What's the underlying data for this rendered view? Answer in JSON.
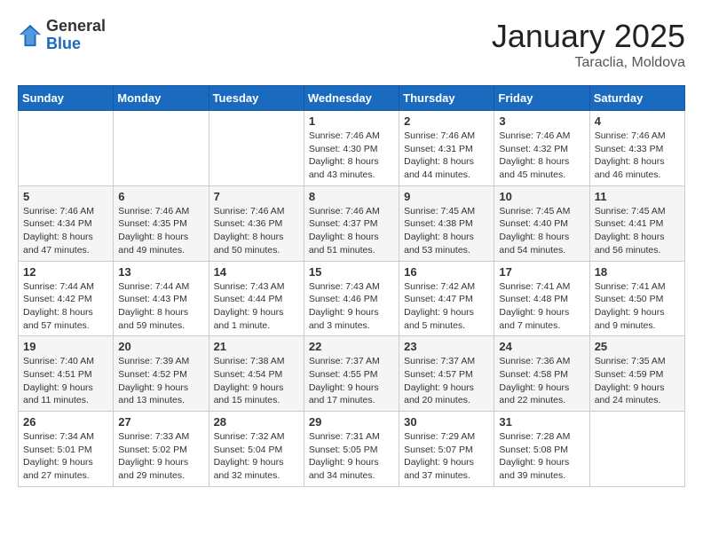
{
  "logo": {
    "general": "General",
    "blue": "Blue"
  },
  "header": {
    "title": "January 2025",
    "subtitle": "Taraclia, Moldova"
  },
  "weekdays": [
    "Sunday",
    "Monday",
    "Tuesday",
    "Wednesday",
    "Thursday",
    "Friday",
    "Saturday"
  ],
  "weeks": [
    [
      {
        "day": "",
        "info": ""
      },
      {
        "day": "",
        "info": ""
      },
      {
        "day": "",
        "info": ""
      },
      {
        "day": "1",
        "info": "Sunrise: 7:46 AM\nSunset: 4:30 PM\nDaylight: 8 hours\nand 43 minutes."
      },
      {
        "day": "2",
        "info": "Sunrise: 7:46 AM\nSunset: 4:31 PM\nDaylight: 8 hours\nand 44 minutes."
      },
      {
        "day": "3",
        "info": "Sunrise: 7:46 AM\nSunset: 4:32 PM\nDaylight: 8 hours\nand 45 minutes."
      },
      {
        "day": "4",
        "info": "Sunrise: 7:46 AM\nSunset: 4:33 PM\nDaylight: 8 hours\nand 46 minutes."
      }
    ],
    [
      {
        "day": "5",
        "info": "Sunrise: 7:46 AM\nSunset: 4:34 PM\nDaylight: 8 hours\nand 47 minutes."
      },
      {
        "day": "6",
        "info": "Sunrise: 7:46 AM\nSunset: 4:35 PM\nDaylight: 8 hours\nand 49 minutes."
      },
      {
        "day": "7",
        "info": "Sunrise: 7:46 AM\nSunset: 4:36 PM\nDaylight: 8 hours\nand 50 minutes."
      },
      {
        "day": "8",
        "info": "Sunrise: 7:46 AM\nSunset: 4:37 PM\nDaylight: 8 hours\nand 51 minutes."
      },
      {
        "day": "9",
        "info": "Sunrise: 7:45 AM\nSunset: 4:38 PM\nDaylight: 8 hours\nand 53 minutes."
      },
      {
        "day": "10",
        "info": "Sunrise: 7:45 AM\nSunset: 4:40 PM\nDaylight: 8 hours\nand 54 minutes."
      },
      {
        "day": "11",
        "info": "Sunrise: 7:45 AM\nSunset: 4:41 PM\nDaylight: 8 hours\nand 56 minutes."
      }
    ],
    [
      {
        "day": "12",
        "info": "Sunrise: 7:44 AM\nSunset: 4:42 PM\nDaylight: 8 hours\nand 57 minutes."
      },
      {
        "day": "13",
        "info": "Sunrise: 7:44 AM\nSunset: 4:43 PM\nDaylight: 8 hours\nand 59 minutes."
      },
      {
        "day": "14",
        "info": "Sunrise: 7:43 AM\nSunset: 4:44 PM\nDaylight: 9 hours\nand 1 minute."
      },
      {
        "day": "15",
        "info": "Sunrise: 7:43 AM\nSunset: 4:46 PM\nDaylight: 9 hours\nand 3 minutes."
      },
      {
        "day": "16",
        "info": "Sunrise: 7:42 AM\nSunset: 4:47 PM\nDaylight: 9 hours\nand 5 minutes."
      },
      {
        "day": "17",
        "info": "Sunrise: 7:41 AM\nSunset: 4:48 PM\nDaylight: 9 hours\nand 7 minutes."
      },
      {
        "day": "18",
        "info": "Sunrise: 7:41 AM\nSunset: 4:50 PM\nDaylight: 9 hours\nand 9 minutes."
      }
    ],
    [
      {
        "day": "19",
        "info": "Sunrise: 7:40 AM\nSunset: 4:51 PM\nDaylight: 9 hours\nand 11 minutes."
      },
      {
        "day": "20",
        "info": "Sunrise: 7:39 AM\nSunset: 4:52 PM\nDaylight: 9 hours\nand 13 minutes."
      },
      {
        "day": "21",
        "info": "Sunrise: 7:38 AM\nSunset: 4:54 PM\nDaylight: 9 hours\nand 15 minutes."
      },
      {
        "day": "22",
        "info": "Sunrise: 7:37 AM\nSunset: 4:55 PM\nDaylight: 9 hours\nand 17 minutes."
      },
      {
        "day": "23",
        "info": "Sunrise: 7:37 AM\nSunset: 4:57 PM\nDaylight: 9 hours\nand 20 minutes."
      },
      {
        "day": "24",
        "info": "Sunrise: 7:36 AM\nSunset: 4:58 PM\nDaylight: 9 hours\nand 22 minutes."
      },
      {
        "day": "25",
        "info": "Sunrise: 7:35 AM\nSunset: 4:59 PM\nDaylight: 9 hours\nand 24 minutes."
      }
    ],
    [
      {
        "day": "26",
        "info": "Sunrise: 7:34 AM\nSunset: 5:01 PM\nDaylight: 9 hours\nand 27 minutes."
      },
      {
        "day": "27",
        "info": "Sunrise: 7:33 AM\nSunset: 5:02 PM\nDaylight: 9 hours\nand 29 minutes."
      },
      {
        "day": "28",
        "info": "Sunrise: 7:32 AM\nSunset: 5:04 PM\nDaylight: 9 hours\nand 32 minutes."
      },
      {
        "day": "29",
        "info": "Sunrise: 7:31 AM\nSunset: 5:05 PM\nDaylight: 9 hours\nand 34 minutes."
      },
      {
        "day": "30",
        "info": "Sunrise: 7:29 AM\nSunset: 5:07 PM\nDaylight: 9 hours\nand 37 minutes."
      },
      {
        "day": "31",
        "info": "Sunrise: 7:28 AM\nSunset: 5:08 PM\nDaylight: 9 hours\nand 39 minutes."
      },
      {
        "day": "",
        "info": ""
      }
    ]
  ]
}
